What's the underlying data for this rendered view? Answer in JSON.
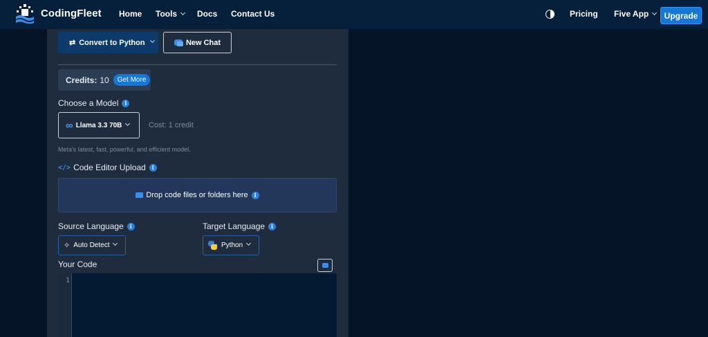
{
  "nav": {
    "brand": "CodingFleet",
    "links": [
      "Home",
      "Tools",
      "Docs",
      "Contact Us"
    ],
    "pricing": "Pricing",
    "five_app": "Five App",
    "upgrade": "Upgrade"
  },
  "toolbar": {
    "convert_label": "Convert to Python",
    "new_chat_label": "New Chat"
  },
  "credits": {
    "label": "Credits:",
    "value": "10",
    "get_more": "Get More"
  },
  "model": {
    "label": "Choose a Model",
    "selected": "Llama 3.3 70B",
    "cost": "Cost: 1 credit",
    "description": "Meta's latest, fast, powerful, and efficient model."
  },
  "upload": {
    "label": "Code Editor Upload",
    "drop_text": "Drop code files or folders here"
  },
  "source_language": {
    "label": "Source Language",
    "selected": "Auto Detect"
  },
  "target_language": {
    "label": "Target Language",
    "selected": "Python"
  },
  "editor": {
    "label": "Your Code",
    "line_number": "1"
  },
  "colors": {
    "background": "#051426",
    "nav": "#06203b",
    "panel": "#1f2c3e",
    "accent": "#1677d9"
  }
}
